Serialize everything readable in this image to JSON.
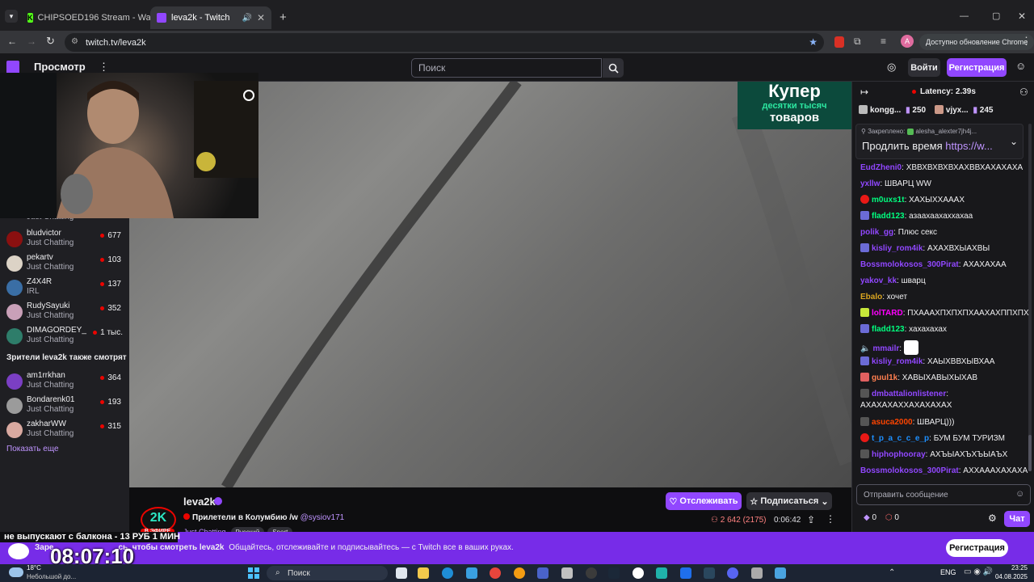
{
  "browser": {
    "tabs": [
      {
        "title": "CHIPSOED196 Stream - Watch",
        "active": false
      },
      {
        "title": "leva2k - Twitch",
        "active": true
      }
    ],
    "url": "twitch.tv/leva2k",
    "profile_initial": "A",
    "update_button": "Доступно обновление Chrome"
  },
  "topnav": {
    "browse": "Просмотр",
    "search_placeholder": "Поиск",
    "login": "Войти",
    "register": "Регистрация"
  },
  "sidebar": {
    "channels": [
      {
        "name": "bludvictor",
        "game": "Just Chatting",
        "viewers": "677"
      },
      {
        "name": "pekartv",
        "game": "Just Chatting",
        "viewers": "103"
      },
      {
        "name": "Z4X4R",
        "game": "IRL",
        "viewers": "137"
      },
      {
        "name": "RudySayuki",
        "game": "Just Chatting",
        "viewers": "352"
      },
      {
        "name": "DIMAGORDEY_",
        "game": "Just Chatting",
        "viewers": "1 тыс."
      }
    ],
    "also_watch_heading": "Зрители leva2k также смотрят",
    "also_watch": [
      {
        "name": "am1rrkhan",
        "game": "Just Chatting",
        "viewers": "364"
      },
      {
        "name": "Bondarenk01",
        "game": "Just Chatting",
        "viewers": "193"
      },
      {
        "name": "zakharWW",
        "game": "Just Chatting",
        "viewers": "315"
      }
    ],
    "show_more": "Показать еще",
    "partial_game": "Just Chatting"
  },
  "video": {
    "ad_line1": "Купер",
    "ad_line2": "десятки тысяч",
    "ad_line3": "товаров"
  },
  "stream_info": {
    "logo_text": "2K",
    "live_label": "В ЭФИРЕ",
    "channel": "leva2k",
    "title": "Прилетели в Колумбию /w",
    "title_mention": "@sysiov171",
    "category": "Just Chatting",
    "tags": [
      "Русский",
      "Sport"
    ],
    "viewers": "2 642",
    "viewers_paren": "(2175)",
    "uptime": "0:06:42",
    "follow": "Отслеживать",
    "subscribe": "Подписаться"
  },
  "chat": {
    "latency": "Latency: 2.39s",
    "gifters": [
      {
        "name": "kongg...",
        "count": "250"
      },
      {
        "name": "vjyx...",
        "count": "245"
      }
    ],
    "pinned_label": "Закреплено:",
    "pinned_by": "alesha_alexter7jh4j...",
    "pinned_text": "Продлить время",
    "pinned_link": "https://w...",
    "messages": [
      {
        "user": "EudZheni0",
        "color": "#9147ff",
        "text": "ХВВХВХВХВХАХВВХАХАХАХА"
      },
      {
        "user": "yxllw",
        "color": "#9147ff",
        "text": "ШВАРЦ WW"
      },
      {
        "user": "m0uxs1t",
        "color": "#00ff7f",
        "text": "ХАХЫХХАААХ"
      },
      {
        "user": "fladd123",
        "color": "#00ff7f",
        "text": "азаахаахаххахаа"
      },
      {
        "user": "polik_gg",
        "color": "#9147ff",
        "text": "Плюс секс"
      },
      {
        "user": "kisliy_rom4ik",
        "color": "#9147ff",
        "text": "АХАХВХЫАХВЫ"
      },
      {
        "user": "Bossmolokosos_300Pirat",
        "color": "#9147ff",
        "text": "АХАХАХАА"
      },
      {
        "user": "yakov_kk",
        "color": "#9147ff",
        "text": "шварц"
      },
      {
        "user": "Ebalo",
        "color": "#daa520",
        "text": "хочет"
      },
      {
        "user": "lolTARD",
        "color": "#ff00ff",
        "text": "ПХАААХПХПХПХААХАХППХПХ"
      },
      {
        "user": "fladd123",
        "color": "#00ff7f",
        "text": "хахахахах"
      },
      {
        "user": "mmailr",
        "color": "#9147ff",
        "text": ""
      },
      {
        "user": "kisliy_rom4ik",
        "color": "#9147ff",
        "text": "ХАЫХВВХЫВХАА"
      },
      {
        "user": "guul1k",
        "color": "#ff7f50",
        "text": "ХАВЫХАВЫХЫХАВ"
      },
      {
        "user": "dmbattalionlistener",
        "color": "#9147ff",
        "text": "АХАХАХАХХАХАХАХАХ"
      },
      {
        "user": "asuca2000",
        "color": "#ff4500",
        "text": "ШВАРЦ)))"
      },
      {
        "user": "t_p_a_c_c_e_p",
        "color": "#1e90ff",
        "text": "БУМ БУМ ТУРИЗМ"
      },
      {
        "user": "hiphophooray",
        "color": "#9147ff",
        "text": "АХЪЫАХЪХЪЫАЪХ"
      },
      {
        "user": "Bossmolokosos_300Pirat",
        "color": "#9147ff",
        "text": "АХХАААХАХАХА"
      }
    ],
    "input_placeholder": "Отправить сообщение",
    "points_a": "0",
    "points_b": "0",
    "chat_button": "Чат"
  },
  "banner": {
    "marquee": "не выпускают с балкона - 13 РУБ 1 МИН",
    "text_part1": "Заре",
    "text_part2": "сь, чтобы смотреть leva2k",
    "text_part3": "Общайтесь, отслеживайте и подписывайтесь — с Twitch все в ваших руках.",
    "clock": "08:07:10",
    "register": "Регистрация"
  },
  "taskbar": {
    "weather_temp": "18°C",
    "weather_desc": "Небольшой до...",
    "search": "Поиск",
    "lang": "ENG",
    "time": "23:25",
    "date": "04.08.2025"
  },
  "colors": {
    "twitch_purple": "#9147ff",
    "live_red": "#eb0400",
    "banner_purple": "#772ce8"
  }
}
